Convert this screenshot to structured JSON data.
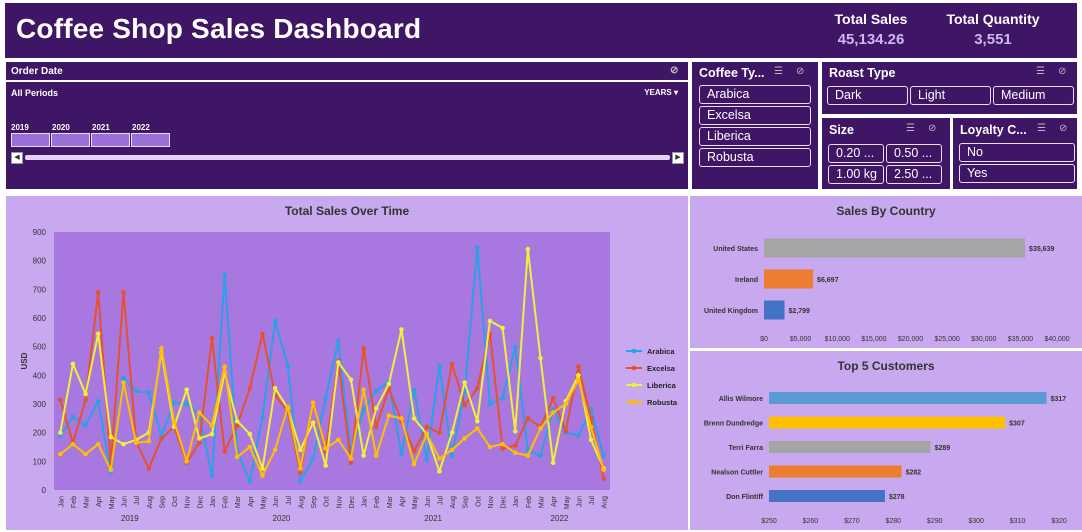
{
  "header": {
    "title": "Coffee Shop Sales Dashboard",
    "total_sales_label": "Total Sales",
    "total_sales_value": "45,134.26",
    "total_qty_label": "Total Quantity",
    "total_qty_value": "3,551"
  },
  "timeline": {
    "label": "Order Date",
    "period": "All Periods",
    "unit": "YEARS",
    "years": [
      "2019",
      "2020",
      "2021",
      "2022"
    ]
  },
  "coffee_type": {
    "title": "Coffee Ty...",
    "items": [
      "Arabica",
      "Excelsa",
      "Liberica",
      "Robusta"
    ]
  },
  "roast_type": {
    "title": "Roast Type",
    "items": [
      "Dark",
      "Light",
      "Medium"
    ]
  },
  "size": {
    "title": "Size",
    "items": [
      "0.20 ...",
      "0.50 ...",
      "1.00 kg",
      "2.50 ..."
    ]
  },
  "loyalty": {
    "title": "Loyalty C...",
    "items": [
      "No",
      "Yes"
    ]
  },
  "colors": {
    "arabica": "#2aa0e8",
    "excelsa": "#e8502e",
    "liberica": "#f0f03a",
    "robusta": "#ffbf00",
    "plot_bg": "#a878e0",
    "panel_bg": "#c8a8ee",
    "header_bg": "#3f1566"
  },
  "chart_data": [
    {
      "type": "line",
      "title": "Total Sales Over Time",
      "ylabel": "USD",
      "ylim": [
        0,
        900
      ],
      "yticks": [
        0,
        100,
        200,
        300,
        400,
        500,
        600,
        700,
        800,
        900
      ],
      "categories": [
        "Jan",
        "Feb",
        "Mar",
        "Apr",
        "May",
        "Jun",
        "Jul",
        "Aug",
        "Sep",
        "Oct",
        "Nov",
        "Dec",
        "Jan",
        "Feb",
        "Mar",
        "Apr",
        "May",
        "Jun",
        "Jul",
        "Aug",
        "Sep",
        "Oct",
        "Nov",
        "Dec",
        "Jan",
        "Feb",
        "Mar",
        "Apr",
        "May",
        "Jun",
        "Jul",
        "Aug",
        "Sep",
        "Oct",
        "Nov",
        "Dec",
        "Jan",
        "Feb",
        "Mar",
        "Apr",
        "May",
        "Jun",
        "Jul",
        "Aug"
      ],
      "year_labels": [
        "2019",
        "2020",
        "2021",
        "2022"
      ],
      "series": [
        {
          "name": "Arabica",
          "values": [
            190,
            255,
            225,
            310,
            60,
            390,
            345,
            340,
            190,
            305,
            300,
            265,
            50,
            750,
            135,
            30,
            255,
            590,
            435,
            30,
            110,
            320,
            520,
            125,
            280,
            345,
            380,
            125,
            350,
            105,
            435,
            120,
            345,
            845,
            300,
            320,
            500,
            140,
            120,
            280,
            200,
            190,
            280,
            120
          ]
        },
        {
          "name": "Excelsa",
          "values": [
            315,
            165,
            315,
            690,
            90,
            690,
            170,
            75,
            180,
            220,
            95,
            165,
            530,
            135,
            225,
            355,
            545,
            330,
            275,
            60,
            305,
            135,
            450,
            95,
            495,
            220,
            355,
            240,
            135,
            220,
            200,
            440,
            295,
            355,
            545,
            145,
            155,
            250,
            220,
            320,
            205,
            430,
            250,
            40
          ]
        },
        {
          "name": "Liberica",
          "values": [
            200,
            440,
            335,
            545,
            185,
            160,
            175,
            200,
            480,
            220,
            350,
            180,
            195,
            410,
            240,
            195,
            75,
            355,
            285,
            140,
            235,
            85,
            445,
            385,
            120,
            285,
            370,
            560,
            250,
            195,
            65,
            200,
            375,
            240,
            590,
            565,
            205,
            840,
            460,
            95,
            310,
            400,
            175,
            75
          ]
        },
        {
          "name": "Robusta",
          "values": [
            125,
            160,
            125,
            160,
            70,
            375,
            165,
            170,
            495,
            240,
            100,
            270,
            225,
            430,
            115,
            150,
            50,
            140,
            290,
            75,
            305,
            145,
            175,
            110,
            350,
            120,
            260,
            250,
            90,
            195,
            110,
            140,
            180,
            215,
            150,
            160,
            130,
            120,
            215,
            270,
            300,
            385,
            220,
            70
          ]
        }
      ]
    },
    {
      "type": "bar",
      "title": "Sales By Country",
      "categories": [
        "United States",
        "Ireland",
        "United Kingdom"
      ],
      "values": [
        35639,
        6697,
        2799
      ],
      "labels": [
        "$35,639",
        "$6,697",
        "$2,799"
      ],
      "xlim": [
        0,
        40000
      ],
      "xticks": [
        "$0",
        "$5,000",
        "$10,000",
        "$15,000",
        "$20,000",
        "$25,000",
        "$30,000",
        "$35,000",
        "$40,000"
      ],
      "colors": [
        "#a5a5a5",
        "#ed7d31",
        "#4472c4"
      ]
    },
    {
      "type": "bar",
      "title": "Top 5 Customers",
      "categories": [
        "Allis Wilmore",
        "Brenn Dundredge",
        "Terri Farra",
        "Nealson Cuttler",
        "Don Flintiff"
      ],
      "values": [
        317,
        307,
        289,
        282,
        278
      ],
      "labels": [
        "$317",
        "$307",
        "$289",
        "$282",
        "$278"
      ],
      "xlim": [
        250,
        320
      ],
      "xticks": [
        "$250",
        "$260",
        "$270",
        "$280",
        "$290",
        "$300",
        "$310",
        "$320"
      ],
      "colors": [
        "#5b9bd5",
        "#ffc000",
        "#a5a5a5",
        "#ed7d31",
        "#4472c4"
      ]
    }
  ]
}
